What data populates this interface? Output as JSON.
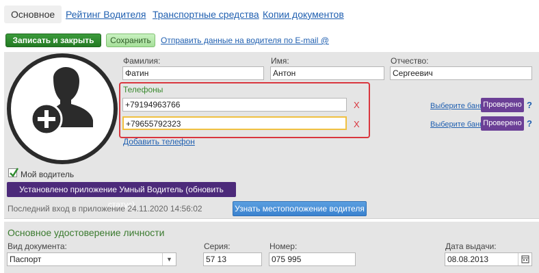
{
  "tabs": [
    {
      "label": "Основное"
    },
    {
      "label": "Рейтинг Водителя"
    },
    {
      "label": "Транспортные средства"
    },
    {
      "label": "Копии документов"
    }
  ],
  "toolbar": {
    "save_close_label": "Записать и закрыть",
    "save_label": "Сохранить",
    "email_link": "Отправить данные на водителя по E-mail @"
  },
  "person": {
    "last_name_label": "Фамилия:",
    "last_name": "Фатин",
    "first_name_label": "Имя:",
    "first_name": "Антон",
    "middle_name_label": "Отчество:",
    "middle_name": "Сергеевич"
  },
  "phones": {
    "title": "Телефоны",
    "items": [
      {
        "value": "+79194963766",
        "delete": "X",
        "bank": "Выберите банк",
        "status": "Проверено",
        "help": "?"
      },
      {
        "value": "+79655792323",
        "delete": "X",
        "bank": "Выберите банк",
        "status": "Проверено",
        "help": "?"
      }
    ],
    "add_label": "Добавить телефон"
  },
  "driver": {
    "my_driver_label": "Мой водитель",
    "my_driver_checked": true,
    "app_button": "Установлено приложение Умный Водитель (обновить статус)",
    "last_login": "Последний вход в приложение 24.11.2020 14:56:02",
    "locate_button": "Узнать местоположение водителя"
  },
  "identity": {
    "section_title": "Основное удостоверение личности",
    "doc_type_label": "Вид документа:",
    "doc_type": "Паспорт",
    "series_label": "Серия:",
    "series": "57 13",
    "number_label": "Номер:",
    "number": "075 995",
    "issue_date_label": "Дата выдачи:",
    "issue_date": "08.08.2013"
  },
  "colors": {
    "accent_green": "#237a23",
    "purple": "#6b3f96",
    "highlight_red": "#d9363e",
    "focus_yellow": "#f0c040",
    "link_blue": "#1f5fb0"
  }
}
